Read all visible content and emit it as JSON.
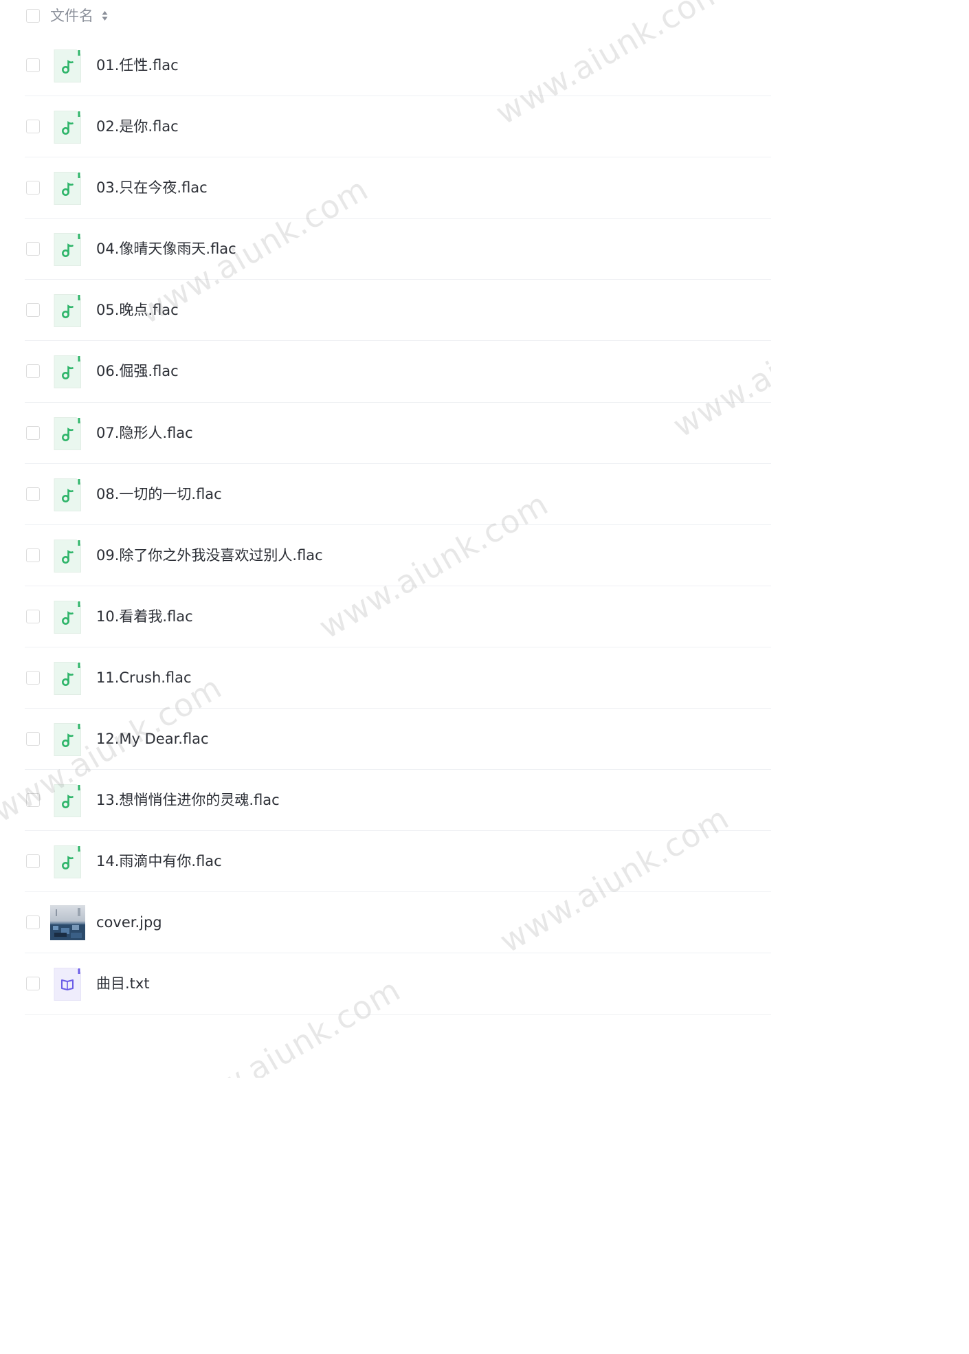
{
  "header": {
    "column_label": "文件名",
    "sort_icon": "sort-caret-icon"
  },
  "files": [
    {
      "name": "01.任性.flac",
      "type": "audio",
      "icon": "music-file-icon"
    },
    {
      "name": "02.是你.flac",
      "type": "audio",
      "icon": "music-file-icon"
    },
    {
      "name": "03.只在今夜.flac",
      "type": "audio",
      "icon": "music-file-icon"
    },
    {
      "name": "04.像晴天像雨天.flac",
      "type": "audio",
      "icon": "music-file-icon"
    },
    {
      "name": "05.晚点.flac",
      "type": "audio",
      "icon": "music-file-icon"
    },
    {
      "name": "06.倔强.flac",
      "type": "audio",
      "icon": "music-file-icon"
    },
    {
      "name": "07.隐形人.flac",
      "type": "audio",
      "icon": "music-file-icon"
    },
    {
      "name": "08.一切的一切.flac",
      "type": "audio",
      "icon": "music-file-icon"
    },
    {
      "name": "09.除了你之外我没喜欢过别人.flac",
      "type": "audio",
      "icon": "music-file-icon"
    },
    {
      "name": "10.看着我.flac",
      "type": "audio",
      "icon": "music-file-icon"
    },
    {
      "name": "11.Crush.flac",
      "type": "audio",
      "icon": "music-file-icon"
    },
    {
      "name": "12.My Dear.flac",
      "type": "audio",
      "icon": "music-file-icon"
    },
    {
      "name": "13.想悄悄住进你的灵魂.flac",
      "type": "audio",
      "icon": "music-file-icon"
    },
    {
      "name": "14.雨滴中有你.flac",
      "type": "audio",
      "icon": "music-file-icon"
    },
    {
      "name": "cover.jpg",
      "type": "image",
      "icon": "image-thumbnail"
    },
    {
      "name": "曲目.txt",
      "type": "text",
      "icon": "book-file-icon"
    }
  ],
  "watermark": "www.aiunk.com",
  "colors": {
    "audio_accent": "#2fb56a",
    "audio_bg": "#eaf7ef",
    "text_accent": "#6b5ce7",
    "text_bg": "#efedfc"
  }
}
